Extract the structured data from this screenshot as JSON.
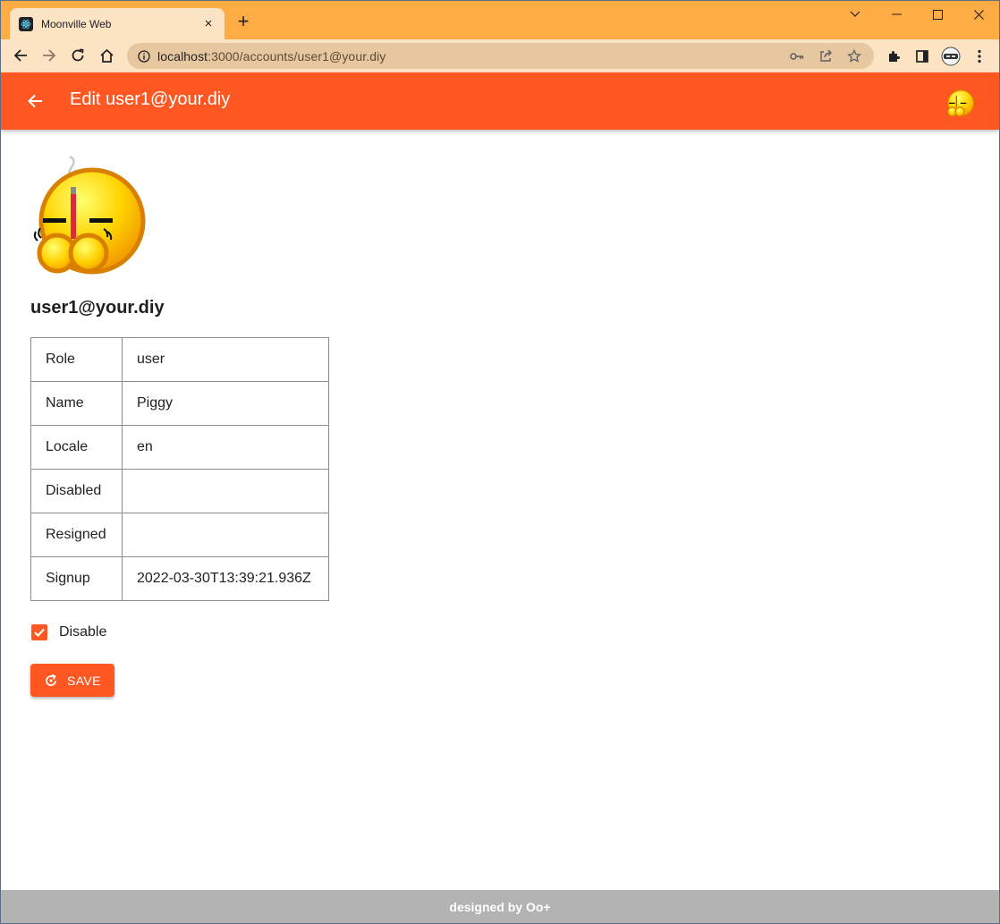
{
  "browser": {
    "tab_title": "Moonville Web",
    "tab_close": "×",
    "new_tab": "+",
    "url_host": "localhost",
    "url_path": ":3000/accounts/user1@your.diy"
  },
  "appbar": {
    "title": "Edit user1@your.diy",
    "color": "#ff5722"
  },
  "account": {
    "title": "user1@your.diy",
    "rows": [
      {
        "key": "Role",
        "value": "user"
      },
      {
        "key": "Name",
        "value": "Piggy"
      },
      {
        "key": "Locale",
        "value": "en"
      },
      {
        "key": "Disabled",
        "value": ""
      },
      {
        "key": "Resigned",
        "value": ""
      },
      {
        "key": "Signup",
        "value": "2022-03-30T13:39:21.936Z"
      }
    ]
  },
  "form": {
    "disable_label": "Disable",
    "disable_checked": true,
    "save_label": "SAVE"
  },
  "footer": {
    "text": "designed by Oo+"
  },
  "icons": {
    "back": "arrow-left-icon",
    "avatar": "praying-emoji-avatar",
    "save": "refresh-icon"
  }
}
